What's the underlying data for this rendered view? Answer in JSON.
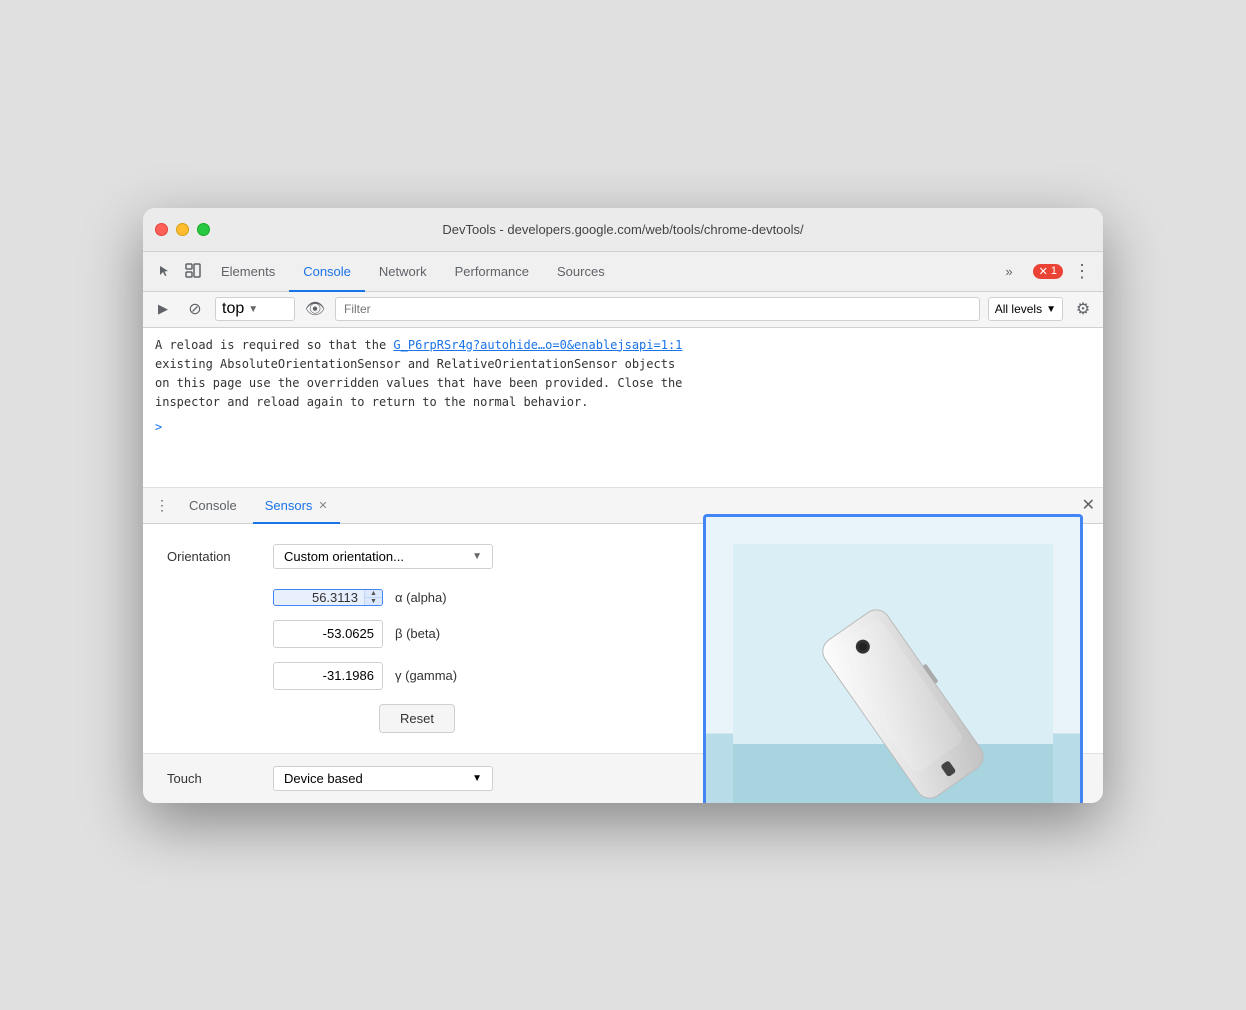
{
  "window": {
    "title": "DevTools - developers.google.com/web/tools/chrome-devtools/"
  },
  "devtools_tabs": {
    "items": [
      {
        "label": "Elements",
        "active": false
      },
      {
        "label": "Console",
        "active": true
      },
      {
        "label": "Network",
        "active": false
      },
      {
        "label": "Performance",
        "active": false
      },
      {
        "label": "Sources",
        "active": false
      }
    ],
    "more_label": "»",
    "error_count": "1",
    "more_options": "⋮"
  },
  "console_toolbar": {
    "play_icon": "▶",
    "block_icon": "⊘",
    "context_value": "top",
    "context_arrow": "▼",
    "eye_icon": "👁",
    "filter_placeholder": "Filter",
    "levels_label": "All levels",
    "levels_arrow": "▼",
    "settings_icon": "⚙"
  },
  "console_output": {
    "message": "A reload is required so that the ",
    "link_text": "G_P6rpRSr4g?autohide…o=0&enablejsapi=1:1",
    "message2": "existing AbsoluteOrientationSensor and RelativeOrientationSensor objects",
    "message3": "on this page use the overridden values that have been provided. Close the",
    "message4": "inspector and reload again to return to the normal behavior.",
    "prompt": ">"
  },
  "bottom_panel": {
    "tabs": [
      {
        "label": "Console",
        "active": false,
        "closeable": false
      },
      {
        "label": "Sensors",
        "active": true,
        "closeable": true
      }
    ],
    "more_label": "⋮",
    "close_label": "✕"
  },
  "sensors": {
    "orientation_label": "Orientation",
    "orientation_value": "Custom orientation...",
    "alpha_value": "56.3113",
    "alpha_label": "α (alpha)",
    "beta_value": "-53.0625",
    "beta_label": "β (beta)",
    "gamma_value": "-31.1986",
    "gamma_label": "γ (gamma)",
    "reset_label": "Reset",
    "touch_label": "Touch",
    "touch_value": "Device based"
  }
}
